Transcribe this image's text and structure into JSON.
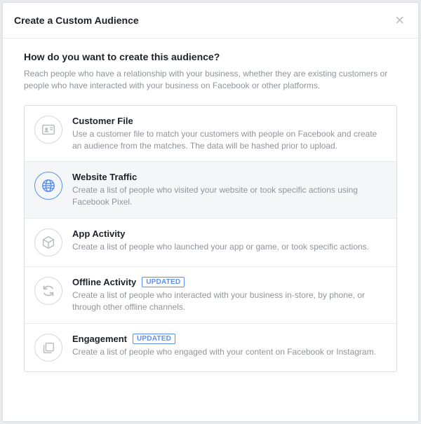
{
  "modal": {
    "title": "Create a Custom Audience",
    "question": "How do you want to create this audience?",
    "description": "Reach people who have a relationship with your business, whether they are existing customers or people who have interacted with your business on Facebook or other platforms.",
    "badge_label": "UPDATED"
  },
  "options": [
    {
      "title": "Customer File",
      "desc": "Use a customer file to match your customers with people on Facebook and create an audience from the matches. The data will be hashed prior to upload.",
      "selected": false,
      "badge": false
    },
    {
      "title": "Website Traffic",
      "desc": "Create a list of people who visited your website or took specific actions using Facebook Pixel.",
      "selected": true,
      "badge": false
    },
    {
      "title": "App Activity",
      "desc": "Create a list of people who launched your app or game, or took specific actions.",
      "selected": false,
      "badge": false
    },
    {
      "title": "Offline Activity",
      "desc": "Create a list of people who interacted with your business in-store, by phone, or through other offline channels.",
      "selected": false,
      "badge": true
    },
    {
      "title": "Engagement",
      "desc": "Create a list of people who engaged with your content on Facebook or Instagram.",
      "selected": false,
      "badge": true
    }
  ]
}
